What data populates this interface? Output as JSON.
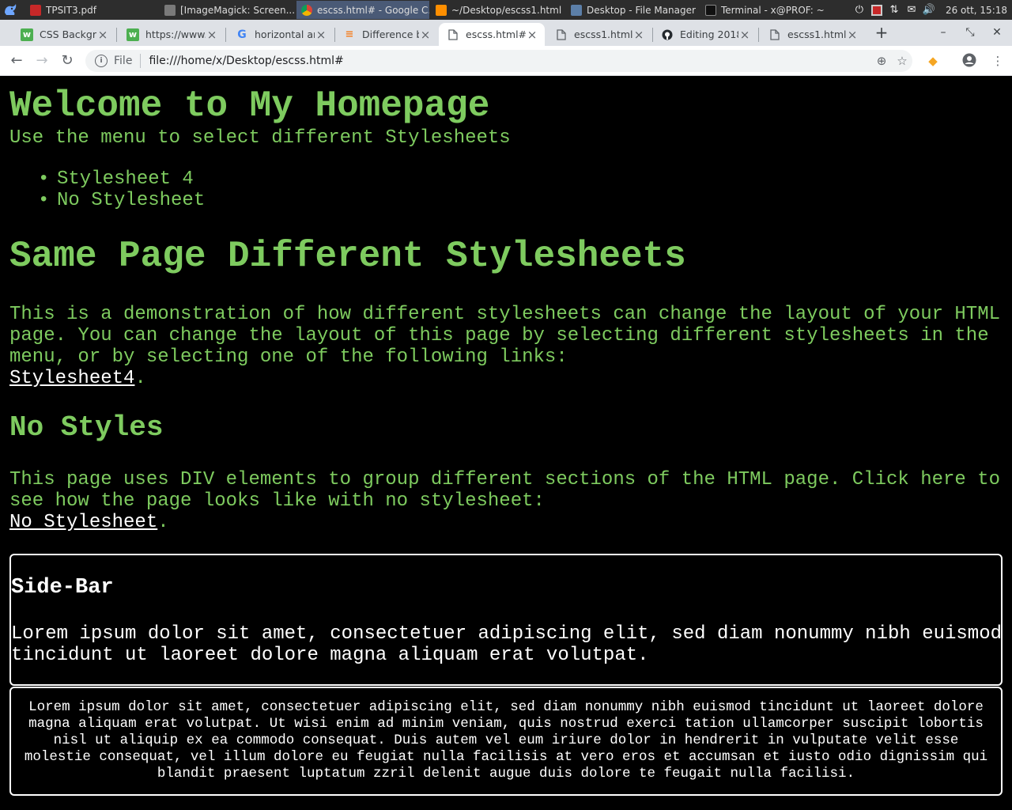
{
  "system_panel": {
    "tasks": [
      {
        "label": "TPSIT3.pdf"
      },
      {
        "label": "[ImageMagick: Screen..."
      },
      {
        "label": "escss.html# - Google C..."
      },
      {
        "label": "~/Desktop/escss1.html ..."
      },
      {
        "label": "Desktop - File Manager"
      },
      {
        "label": "Terminal - x@PROF: ~"
      }
    ],
    "clock": "26 ott, 15:18"
  },
  "browser": {
    "tabs": [
      {
        "title": "CSS Backgro"
      },
      {
        "title": "https://www."
      },
      {
        "title": "horizontal ar"
      },
      {
        "title": "Difference b"
      },
      {
        "title": "escss.html#"
      },
      {
        "title": "escss1.html#"
      },
      {
        "title": "Editing 2018"
      },
      {
        "title": "escss1.html#"
      }
    ],
    "scheme_label": "File",
    "url": "file:///home/x/Desktop/escss.html#"
  },
  "page": {
    "title": "Welcome to My Homepage",
    "subtitle": "Use the menu to select different Stylesheets",
    "menu": [
      "Stylesheet 4",
      "No Stylesheet"
    ],
    "heading2": "Same Page Different Stylesheets",
    "intro_text": "This is a demonstration of how different stylesheets can change the layout of your HTML page. You can change the layout of this page by selecting different stylesheets in the menu, or by selecting one of the following links:",
    "intro_link": "Stylesheet4",
    "no_styles_heading": "No Styles",
    "no_styles_text": "This page uses DIV elements to group different sections of the HTML page. Click here to see how the page looks like with no stylesheet:",
    "no_styles_link": "No Stylesheet",
    "period": ".",
    "sidebar_heading": "Side-Bar",
    "sidebar_text_line1": "Lorem ipsum dolor sit amet, consectetuer adipiscing elit, sed diam nonummy nibh euismod",
    "sidebar_text_line2": "tincidunt ut laoreet dolore magna aliquam erat volutpat.",
    "main_text": "Lorem ipsum dolor sit amet, consectetuer adipiscing elit, sed diam nonummy nibh euismod tincidunt ut laoreet dolore magna aliquam erat volutpat. Ut wisi enim ad minim veniam, quis nostrud exerci tation ullamcorper suscipit lobortis nisl ut aliquip ex ea commodo consequat. Duis autem vel eum iriure dolor in hendrerit in vulputate velit esse molestie consequat, vel illum dolore eu feugiat nulla facilisis at vero eros et accumsan et iusto odio dignissim qui blandit praesent luptatum zzril delenit augue duis dolore te feugait nulla facilisi."
  },
  "colors": {
    "page_background": "#000000",
    "page_text": "#7ecb5f",
    "link": "#ffffff",
    "panel": "#2d2d2d",
    "tabstrip": "#dee1e6"
  }
}
